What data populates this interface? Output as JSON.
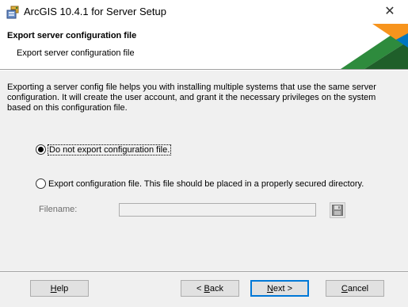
{
  "window": {
    "title": "ArcGIS 10.4.1 for Server Setup",
    "close_glyph": "✕",
    "icon": "installer-icon"
  },
  "banner": {
    "title": "Export server configuration file",
    "subtitle": "Export server configuration file",
    "colors": {
      "orange": "#f7941d",
      "blue": "#0076c0",
      "green": "#2e8b3d",
      "dark_green": "#1f5f2a"
    }
  },
  "body": {
    "description": "Exporting a server config file helps you with installing multiple systems that use the same server configuration.  It will create the user account, and grant it the necessary privileges on the system based on this configuration file.",
    "options": [
      {
        "label": "Do not export configuration file.",
        "checked": true
      },
      {
        "label": "Export configuration file. This file should be placed in a properly secured directory.",
        "checked": false
      }
    ],
    "filename": {
      "label": "Filename:",
      "value": ""
    },
    "browse_icon": "floppy-disk-icon"
  },
  "footer": {
    "help": {
      "pre": "",
      "key": "H",
      "post": "elp"
    },
    "back": {
      "pre": "< ",
      "key": "B",
      "post": "ack"
    },
    "next": {
      "pre": "",
      "key": "N",
      "post": "ext >"
    },
    "cancel": {
      "pre": "",
      "key": "C",
      "post": "ancel"
    }
  }
}
